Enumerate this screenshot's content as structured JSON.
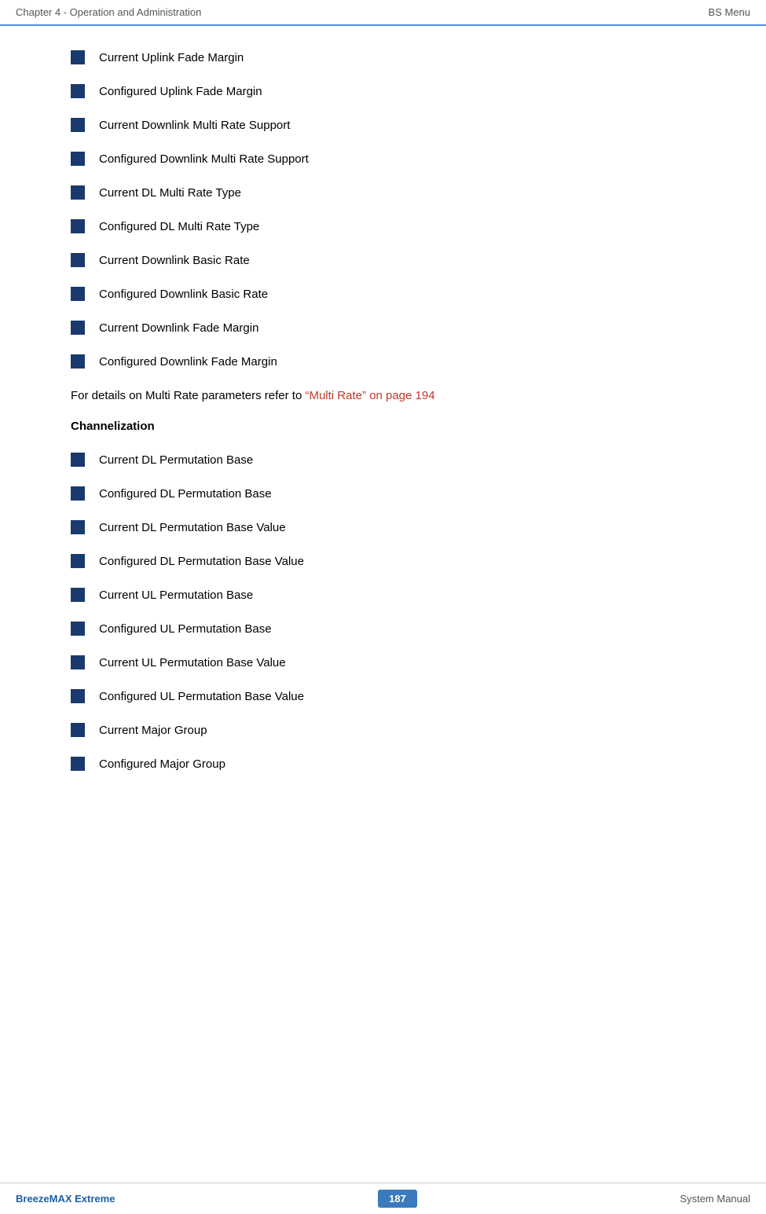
{
  "header": {
    "left": "Chapter 4 - Operation and Administration",
    "right": "BS Menu"
  },
  "footer": {
    "left": "BreezeMAX Extreme",
    "center": "187",
    "right": "System Manual"
  },
  "content": {
    "bullet_items": [
      "Current Uplink Fade Margin",
      "Configured Uplink Fade Margin",
      "Current Downlink Multi Rate Support",
      "Configured Downlink Multi Rate Support",
      "Current DL Multi Rate Type",
      "Configured DL Multi Rate Type",
      "Current Downlink Basic Rate",
      "Configured Downlink Basic Rate",
      "Current Downlink Fade Margin",
      "Configured Downlink Fade Margin"
    ],
    "para_prefix": "For details on Multi Rate parameters refer to ",
    "para_link_text": "“Multi Rate” on page 194",
    "section_heading": "Channelization",
    "channelization_items": [
      "Current DL Permutation Base",
      "Configured DL Permutation Base",
      "Current DL Permutation Base Value",
      "Configured DL Permutation Base Value",
      "Current UL Permutation Base",
      "Configured UL Permutation Base",
      "Current UL Permutation Base Value",
      "Configured UL Permutation Base Value",
      "Current Major Group",
      "Configured Major Group"
    ]
  }
}
